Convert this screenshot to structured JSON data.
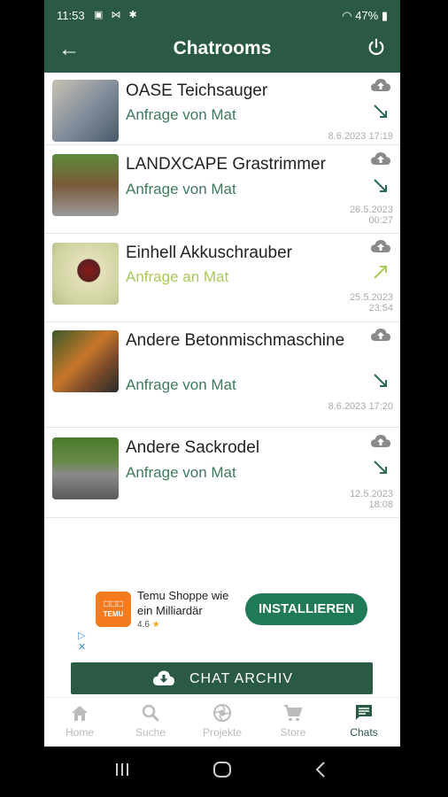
{
  "status": {
    "time": "11:53",
    "icons": "▣ ⋈ ✱",
    "battery": "47%"
  },
  "header": {
    "title": "Chatrooms"
  },
  "chats": [
    {
      "title": "OASE Teichsauger",
      "subtitle": "Anfrage von Mat",
      "date": "8.6.2023 17:19",
      "direction": "incoming"
    },
    {
      "title": "LANDXCAPE Grastrimmer",
      "subtitle": "Anfrage von Mat",
      "date": "26.5.2023",
      "time": "00:27",
      "direction": "incoming"
    },
    {
      "title": "Einhell Akkuschrauber",
      "subtitle": "Anfrage an Mat",
      "date": "25.5.2023",
      "time": "23:54",
      "direction": "outgoing"
    },
    {
      "title": "Andere Betonmischmaschine",
      "subtitle": "Anfrage von Mat",
      "date": "8.6.2023 17:20",
      "direction": "incoming"
    },
    {
      "title": "Andere Sackrodel",
      "subtitle": "Anfrage von Mat",
      "date": "12.5.2023",
      "time": "18:08",
      "direction": "incoming"
    }
  ],
  "ad": {
    "logo": "TEMU",
    "title": "Temu Shoppe wie ein Milliardär",
    "rating": "4.6",
    "star": "★",
    "button": "INSTALLIEREN"
  },
  "archive": {
    "label": "CHAT ARCHIV"
  },
  "nav": [
    {
      "label": "Home"
    },
    {
      "label": "Suche"
    },
    {
      "label": "Projekte"
    },
    {
      "label": "Store"
    },
    {
      "label": "Chats"
    }
  ],
  "colors": {
    "primary": "#2a5a43",
    "accent": "#3f7a5e",
    "outgoing": "#a9c95a"
  }
}
